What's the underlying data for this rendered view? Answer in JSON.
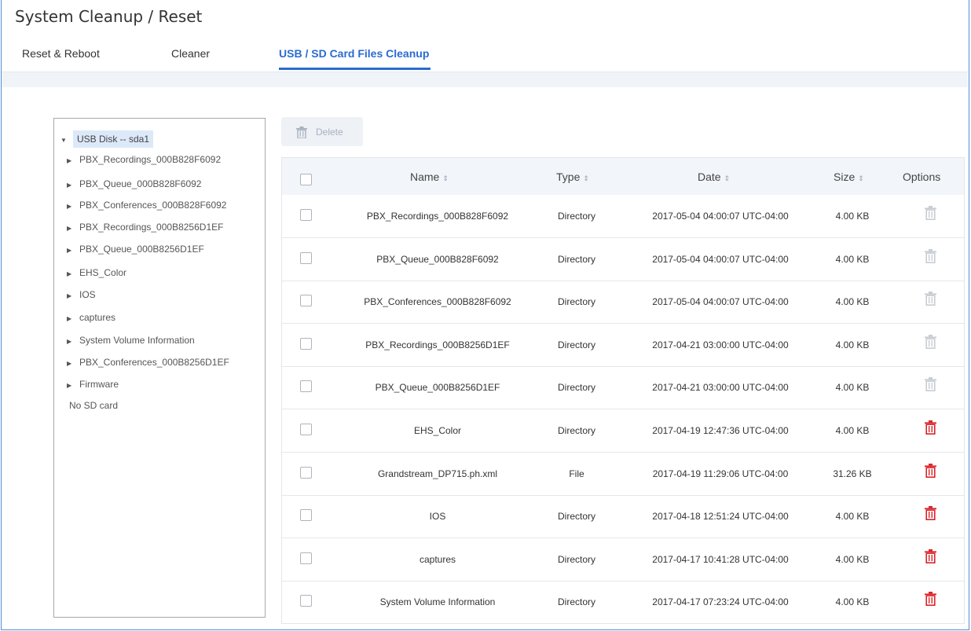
{
  "page": {
    "title": "System Cleanup / Reset"
  },
  "tabs": [
    {
      "label": "Reset & Reboot",
      "active": false
    },
    {
      "label": "Cleaner",
      "active": false
    },
    {
      "label": "USB / SD Card Files Cleanup",
      "active": true
    }
  ],
  "tree": {
    "root": "USB Disk -- sda1",
    "children": [
      "PBX_Recordings_000B828F6092",
      "PBX_Queue_000B828F6092",
      "PBX_Conferences_000B828F6092",
      "PBX_Recordings_000B8256D1EF",
      "PBX_Queue_000B8256D1EF",
      "EHS_Color",
      "IOS",
      "captures",
      "System Volume Information",
      "PBX_Conferences_000B8256D1EF",
      "Firmware"
    ],
    "no_sd": "No SD card"
  },
  "toolbar": {
    "delete_label": "Delete",
    "delete_icon": "trash-icon"
  },
  "table": {
    "headers": {
      "name": "Name",
      "type": "Type",
      "date": "Date",
      "size": "Size",
      "options": "Options"
    },
    "rows": [
      {
        "name": "PBX_Recordings_000B828F6092",
        "type": "Directory",
        "date": "2017-05-04 04:00:07 UTC-04:00",
        "size": "4.00 KB",
        "deletable": false
      },
      {
        "name": "PBX_Queue_000B828F6092",
        "type": "Directory",
        "date": "2017-05-04 04:00:07 UTC-04:00",
        "size": "4.00 KB",
        "deletable": false
      },
      {
        "name": "PBX_Conferences_000B828F6092",
        "type": "Directory",
        "date": "2017-05-04 04:00:07 UTC-04:00",
        "size": "4.00 KB",
        "deletable": false
      },
      {
        "name": "PBX_Recordings_000B8256D1EF",
        "type": "Directory",
        "date": "2017-04-21 03:00:00 UTC-04:00",
        "size": "4.00 KB",
        "deletable": false
      },
      {
        "name": "PBX_Queue_000B8256D1EF",
        "type": "Directory",
        "date": "2017-04-21 03:00:00 UTC-04:00",
        "size": "4.00 KB",
        "deletable": false
      },
      {
        "name": "EHS_Color",
        "type": "Directory",
        "date": "2017-04-19 12:47:36 UTC-04:00",
        "size": "4.00 KB",
        "deletable": true
      },
      {
        "name": "Grandstream_DP715.ph.xml",
        "type": "File",
        "date": "2017-04-19 11:29:06 UTC-04:00",
        "size": "31.26 KB",
        "deletable": true
      },
      {
        "name": "IOS",
        "type": "Directory",
        "date": "2017-04-18 12:51:24 UTC-04:00",
        "size": "4.00 KB",
        "deletable": true
      },
      {
        "name": "captures",
        "type": "Directory",
        "date": "2017-04-17 10:41:28 UTC-04:00",
        "size": "4.00 KB",
        "deletable": true
      },
      {
        "name": "System Volume Information",
        "type": "Directory",
        "date": "2017-04-17 07:23:24 UTC-04:00",
        "size": "4.00 KB",
        "deletable": true
      }
    ]
  },
  "colors": {
    "accent": "#2a6bd1",
    "trash_active": "#d9262c",
    "trash_disabled": "#c8cdd3",
    "tree_selected": "#dce9f9"
  }
}
